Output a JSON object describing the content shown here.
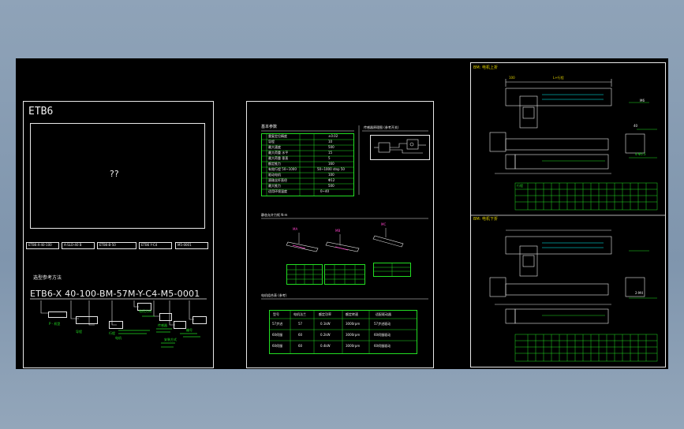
{
  "sheet1": {
    "title": "ETB6",
    "image_placeholder": "??",
    "tags": [
      "ETB6-X-40-100",
      "A-SLO-40 B",
      "ETB6-B-50",
      "ETB6 Y-C4",
      "M5-0001"
    ],
    "ordering_title": "选型参考方法",
    "model_code": "ETB6-X 40-100-BM-57M-Y-C4-M5-0001",
    "code_labels": [
      "P - 机型",
      "导程",
      "行程",
      "电机",
      "电机方向",
      "传感器",
      "安装方式",
      "编号"
    ]
  },
  "sheet2": {
    "params_title": "基本参数",
    "params_rows": [
      [
        "重复定位精度",
        "mm",
        "±0.02"
      ],
      [
        "导程",
        "mm",
        "10"
      ],
      [
        "最大速度",
        "mm/s",
        "500"
      ],
      [
        "最大荷重 水平",
        "kg",
        "15"
      ],
      [
        "最大荷重 垂直",
        "kg",
        "5"
      ],
      [
        "额定推力",
        "N",
        "160"
      ],
      [
        "有效行程 50~1000",
        "mm",
        "50~1000 step 50"
      ],
      [
        "驱动电机",
        "W",
        "100"
      ],
      [
        "滚珠丝杆直径",
        "mm",
        "Φ12"
      ],
      [
        "最大推力",
        "N",
        "500"
      ],
      [
        "适用环境温度",
        "°C",
        "0~40"
      ]
    ],
    "circuit_title": "传感器原理图 (参考开关)",
    "moment_title": "静态允许力矩 N·m",
    "moment_values": [
      "MA",
      "MB",
      "MC"
    ],
    "motor_title": "电机组合表 (参考)",
    "motor_headers": [
      "型号",
      "电机法兰",
      "额定功率",
      "额定转速",
      "适配驱动器"
    ],
    "motor_rows": [
      [
        "57步进",
        "57",
        "0.1kW",
        "3000rpm",
        "57步进驱动"
      ],
      [
        "60伺服",
        "60",
        "0.2kW",
        "3000rpm",
        "60伺服驱动"
      ],
      [
        "60伺服",
        "60",
        "0.4kW",
        "3000rpm",
        "60伺服驱动"
      ]
    ]
  },
  "sheet3": {
    "view_top_title": "BM: 电机上折",
    "view_bottom_title": "BM: 电机下折",
    "dim_labels": [
      "100",
      "L+行程",
      "40",
      "M6",
      "4-Φ5.5",
      "2-M4"
    ],
    "table_headers": [
      "行程",
      "50",
      "100",
      "150",
      "200",
      "250",
      "300",
      "350",
      "400",
      "450",
      "500",
      "550",
      "600",
      "650",
      "700",
      "750",
      "800",
      "850",
      "900"
    ],
    "table_rows": 4
  },
  "colors": {
    "background": "#000000",
    "line": "#e8e8e8",
    "green": "#22dd22",
    "yellow": "#e0d000"
  }
}
